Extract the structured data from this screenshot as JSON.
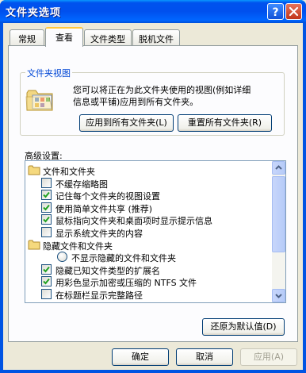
{
  "window": {
    "title": "文件夹选项"
  },
  "tabs": [
    {
      "label": "常规",
      "active": false
    },
    {
      "label": "查看",
      "active": true
    },
    {
      "label": "文件类型",
      "active": false
    },
    {
      "label": "脱机文件",
      "active": false
    }
  ],
  "folder_views": {
    "legend": "文件夹视图",
    "desc_line1": "您可以将正在为此文件夹使用的视图(例如详细",
    "desc_line2": "信息或平铺)应用到所有文件夹。",
    "apply_all_button": "应用到所有文件夹(L)",
    "reset_all_button": "重置所有文件夹(R)"
  },
  "advanced": {
    "label": "高级设置:",
    "items": [
      {
        "type": "folder",
        "label": "文件和文件夹"
      },
      {
        "type": "checkbox",
        "label": "不缓存缩略图",
        "checked": false
      },
      {
        "type": "checkbox",
        "label": "记住每个文件夹的视图设置",
        "checked": true
      },
      {
        "type": "checkbox",
        "label": "使用简单文件共享 (推荐)",
        "checked": true
      },
      {
        "type": "checkbox",
        "label": "鼠标指向文件夹和桌面项时显示提示信息",
        "checked": true
      },
      {
        "type": "checkbox",
        "label": "显示系统文件夹的内容",
        "checked": false
      },
      {
        "type": "folder",
        "label": "隐藏文件和文件夹"
      },
      {
        "type": "radio",
        "label": "不显示隐藏的文件和文件夹",
        "checked": false
      },
      {
        "type": "checkbox",
        "label": "隐藏已知文件类型的扩展名",
        "checked": true
      },
      {
        "type": "checkbox",
        "label": "用彩色显示加密或压缩的 NTFS 文件",
        "checked": true
      },
      {
        "type": "checkbox",
        "label": "在标题栏显示完整路径",
        "checked": false
      }
    ],
    "scroll_position": 0.05,
    "restore_defaults_button": "还原为默认值(D)"
  },
  "footer": {
    "ok_button": "确定",
    "cancel_button": "取消",
    "apply_button": "应用(A)",
    "apply_enabled": false
  },
  "colors": {
    "titlebar": "#0054e3",
    "active_tab_accent": "#ffc83c",
    "group_legend": "#0046d5",
    "check_mark": "#21a121"
  }
}
